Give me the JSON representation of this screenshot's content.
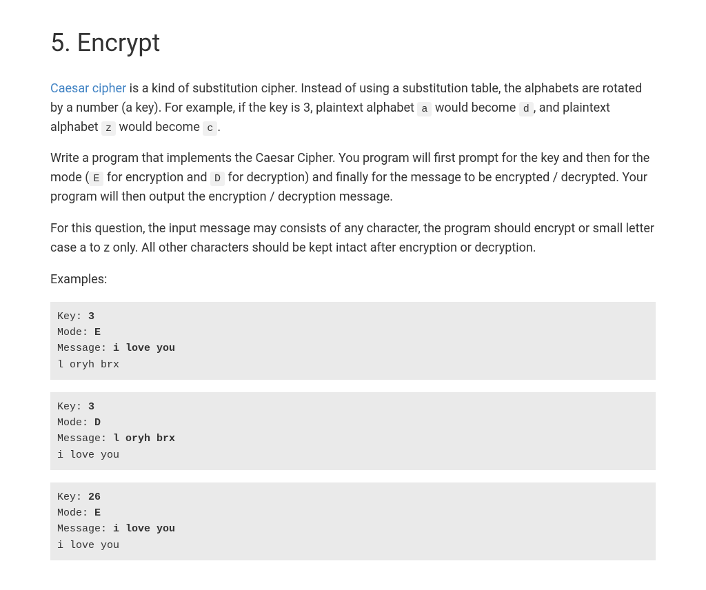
{
  "heading": "5. Encrypt",
  "para1": {
    "link_text": "Caesar cipher",
    "text1": " is a kind of substitution cipher. Instead of using a substitution table, the alphabets are rotated by a number (a key). For example, if the key is 3, plaintext alphabet ",
    "code1": "a",
    "text2": " would become ",
    "code2": "d",
    "text3": ", and plaintext alphabet ",
    "code3": "z",
    "text4": " would become ",
    "code4": "c",
    "text5": "."
  },
  "para2": {
    "text1": "Write a program that implements the Caesar Cipher. You program will first prompt for the key and then for the mode (",
    "code1": "E",
    "text2": " for encryption and ",
    "code2": "D",
    "text3": " for decryption) and finally for the message to be encrypted / decrypted. Your program will then output the encryption / decryption message."
  },
  "para3": "For this question, the input message may consists of any character, the program should encrypt or small letter case a to z only. All other characters should be kept intact after encryption or decryption.",
  "para4": "Examples:",
  "example1": {
    "line1a": "Key: ",
    "line1b": "3",
    "line2a": "Mode: ",
    "line2b": "E",
    "line3a": "Message: ",
    "line3b": "i love you",
    "line4": "l oryh brx"
  },
  "example2": {
    "line1a": "Key: ",
    "line1b": "3",
    "line2a": "Mode: ",
    "line2b": "D",
    "line3a": "Message: ",
    "line3b": "l oryh brx",
    "line4": "i love you"
  },
  "example3": {
    "line1a": "Key: ",
    "line1b": "26",
    "line2a": "Mode: ",
    "line2b": "E",
    "line3a": "Message: ",
    "line3b": "i love you",
    "line4": "i love you"
  }
}
